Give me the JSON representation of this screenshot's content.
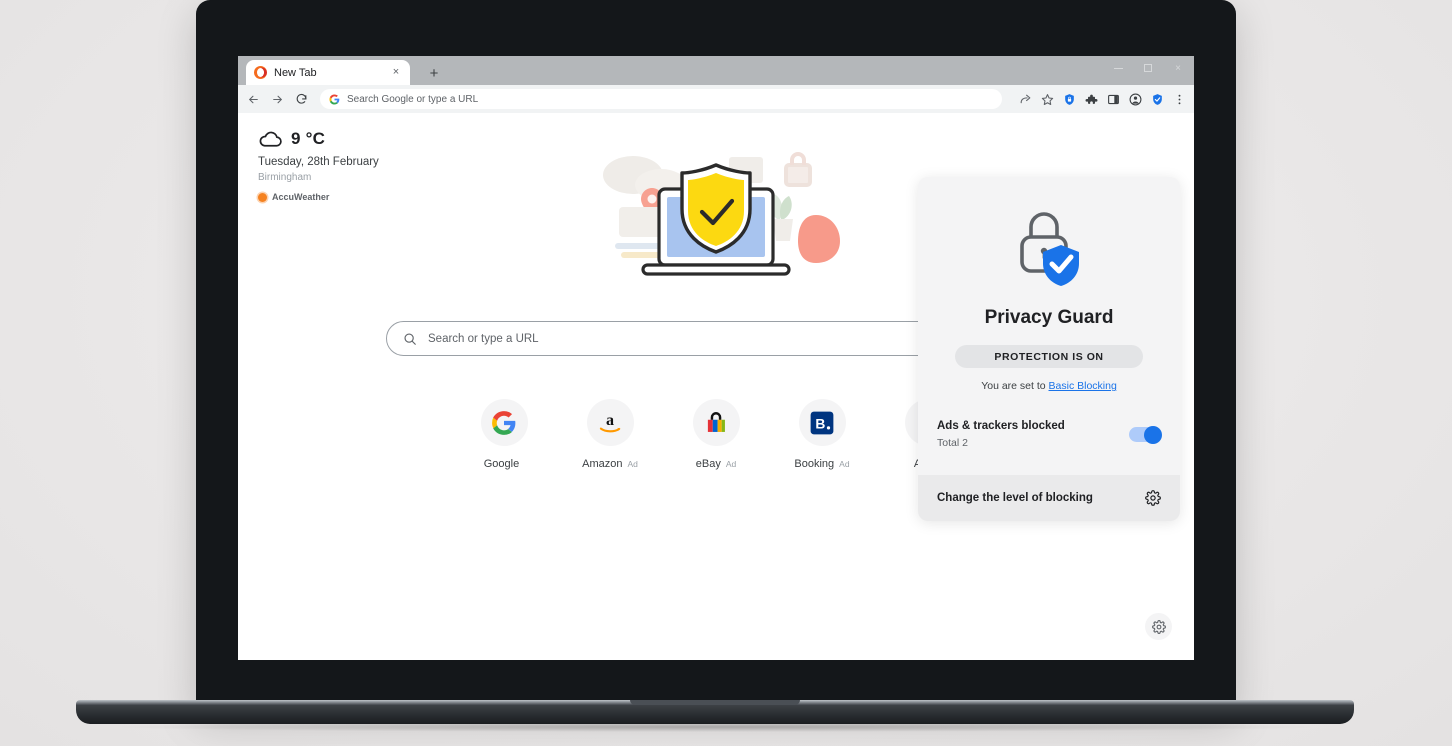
{
  "browser": {
    "tab": {
      "title": "New Tab",
      "favicon": "opera-logo-icon",
      "close_label": "×"
    },
    "new_tab_button": "+",
    "window_controls": {
      "minimize": "minimize-icon",
      "maximize": "maximize-icon",
      "close": "×"
    },
    "toolbar": {
      "back": "back-arrow-icon",
      "forward": "forward-arrow-icon",
      "reload": "reload-icon",
      "omnibox_placeholder": "Search Google or type a URL",
      "search_engine_icon": "google-g-icon",
      "right_icons": [
        "share-icon",
        "bookmark-star-icon",
        "privacy-shield-lock-icon",
        "extensions-puzzle-icon",
        "side-panel-icon",
        "profile-avatar-icon",
        "privacy-guard-shield-icon",
        "more-menu-icon"
      ]
    }
  },
  "weather": {
    "icon": "cloud-icon",
    "temperature": "9 °C",
    "date": "Tuesday, 28th February",
    "city": "Birmingham",
    "provider": "AccuWeather"
  },
  "search": {
    "placeholder": "Search or type a URL",
    "icon": "search-magnifier-icon"
  },
  "shortcuts": [
    {
      "label": "Google",
      "ad": "",
      "icon": "google-logo-icon"
    },
    {
      "label": "Amazon",
      "ad": "Ad",
      "icon": "amazon-logo-icon"
    },
    {
      "label": "eBay",
      "ad": "Ad",
      "icon": "ebay-bag-icon"
    },
    {
      "label": "Booking",
      "ad": "Ad",
      "icon": "booking-logo-icon"
    },
    {
      "label": "Add s",
      "ad": "",
      "icon": "add-shortcut-icon"
    }
  ],
  "panel": {
    "icon": "padlock-with-shield-check-icon",
    "title": "Privacy Guard",
    "status_badge": "PROTECTION IS ON",
    "level_prefix": "You are set to ",
    "level_link": "Basic Blocking",
    "row_title": "Ads & trackers blocked",
    "row_subtitle": "Total 2",
    "toggle_on": true,
    "footer_text": "Change the level of blocking",
    "footer_icon": "gear-icon"
  },
  "page_settings_icon": "gear-icon",
  "colors": {
    "accent_blue": "#1a73e8",
    "toggle_track": "#aecbfa",
    "panel_bg": "#f4f4f5",
    "shield_yellow": "#fdd835",
    "accuweather_orange": "#f58220"
  }
}
